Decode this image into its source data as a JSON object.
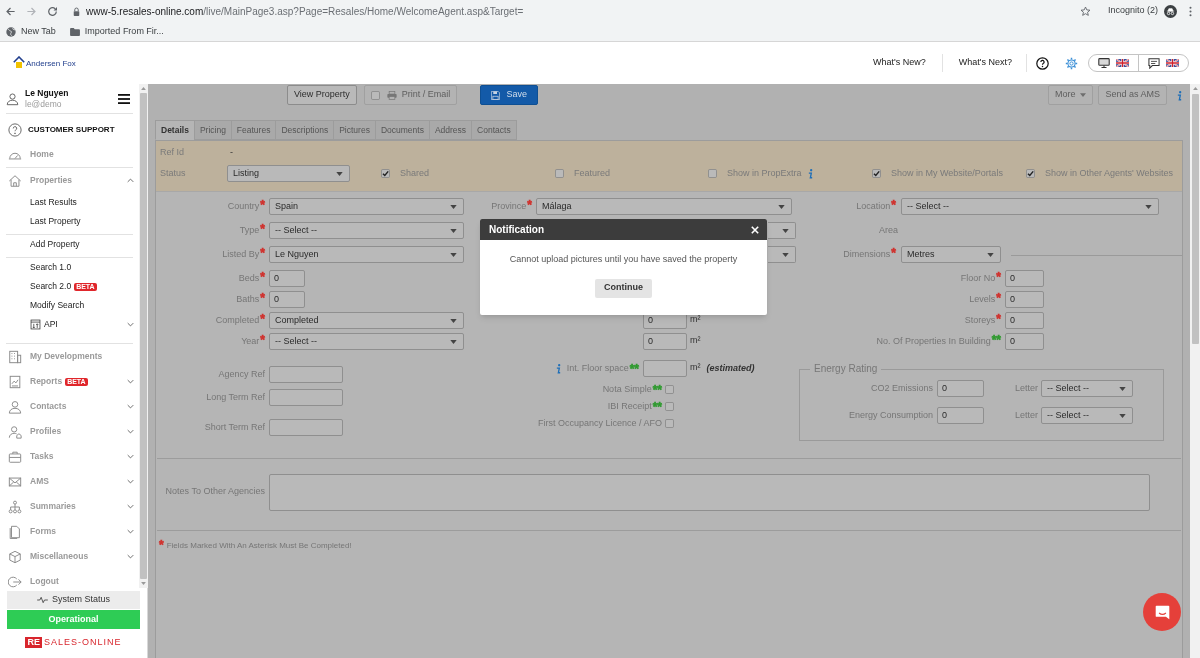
{
  "browser": {
    "url_host": "www-5.resales-online.com",
    "url_path": "/live/MainPage3.asp?Page=Resales/Home/WelcomeAgent.asp&Target=",
    "profile": "Incognito (2)",
    "bookmarks": [
      {
        "kind": "site",
        "label": "New Tab"
      },
      {
        "kind": "folder",
        "label": "Imported From Fir..."
      }
    ]
  },
  "header": {
    "logo": "Andersen Fox",
    "links": [
      "What's New?",
      "What's Next?"
    ],
    "language_buttons": [
      {
        "kind": "screen"
      },
      {
        "kind": "chat"
      }
    ]
  },
  "sidebar": {
    "user": {
      "name": "Le Nguyen",
      "email": "le@demo"
    },
    "support": "CUSTOMER SUPPORT",
    "items": [
      {
        "kind": "link",
        "label": "Home"
      },
      {
        "kind": "group",
        "label": "Properties",
        "expanded": true,
        "children": [
          {
            "items": [
              {
                "kind": "link",
                "label": "Last Results"
              },
              {
                "kind": "link",
                "label": "Last Property"
              }
            ]
          },
          {
            "items": [
              {
                "kind": "link",
                "label": "Add Property"
              }
            ]
          },
          {
            "items": [
              {
                "kind": "link",
                "label": "Search 1.0"
              },
              {
                "kind": "link",
                "label": "Search 2.0",
                "badge": "BETA"
              },
              {
                "kind": "link",
                "label": "Modify Search"
              },
              {
                "kind": "group",
                "label": "API",
                "expanded": false
              }
            ]
          }
        ]
      },
      {
        "kind": "link",
        "label": "My Developments"
      },
      {
        "kind": "group",
        "label": "Reports",
        "badge": "BETA",
        "expanded": false
      },
      {
        "kind": "group",
        "label": "Contacts",
        "expanded": false
      },
      {
        "kind": "group",
        "label": "Profiles",
        "expanded": false
      },
      {
        "kind": "group",
        "label": "Tasks",
        "expanded": false
      },
      {
        "kind": "group",
        "label": "AMS",
        "expanded": false
      },
      {
        "kind": "group",
        "label": "Summaries",
        "expanded": false
      },
      {
        "kind": "group",
        "label": "Forms",
        "expanded": false
      },
      {
        "kind": "group",
        "label": "Miscellaneous",
        "expanded": false
      },
      {
        "kind": "link",
        "label": "Logout"
      }
    ],
    "status": {
      "label": "System Status",
      "state": "Operational"
    },
    "brand": {
      "mark": "RE",
      "name": "SALES-ONLINE"
    }
  },
  "toolbar": {
    "buttons": [
      {
        "kind": "default",
        "label": "View Property",
        "disabled": false
      },
      {
        "kind": "print",
        "label": "Print / Email",
        "disabled": true,
        "checked": false
      },
      {
        "kind": "primary",
        "label": "Save",
        "disabled": false
      }
    ],
    "actions": [
      {
        "kind": "dropdown",
        "label": "More",
        "disabled": true
      },
      {
        "kind": "default",
        "label": "Send as AMS",
        "disabled": true
      }
    ]
  },
  "tabs": [
    {
      "label": "Details",
      "selected": true
    },
    {
      "label": "Pricing",
      "selected": false
    },
    {
      "label": "Features",
      "selected": false
    },
    {
      "label": "Descriptions",
      "selected": false
    },
    {
      "label": "Pictures",
      "selected": false
    },
    {
      "label": "Documents",
      "selected": false
    },
    {
      "label": "Address",
      "selected": false
    },
    {
      "label": "Contacts",
      "selected": false
    }
  ],
  "listing": {
    "ref_id": {
      "label": "Ref Id",
      "value": "-"
    },
    "status": {
      "label": "Status",
      "value": "Listing"
    },
    "flags": [
      {
        "label": "Shared",
        "checked": true
      },
      {
        "label": "Featured",
        "checked": false
      },
      {
        "label": "Show in PropExtra",
        "checked": false,
        "info": true
      },
      {
        "label": "Show in My Website/Portals",
        "checked": true
      },
      {
        "label": "Show in Other Agents' Websites",
        "checked": true
      }
    ]
  },
  "fields": {
    "left": [
      {
        "kind": "select",
        "label": "Country",
        "marker": {
          "text": "*",
          "color": "#d0312d"
        },
        "value": "Spain"
      },
      {
        "kind": "select",
        "label": "Type",
        "marker": {
          "text": "*",
          "color": "#d0312d"
        },
        "value": "-- Select --"
      },
      {
        "kind": "select",
        "label": "Listed By",
        "marker": {
          "text": "*",
          "color": "#d0312d"
        },
        "value": "Le Nguyen"
      },
      {
        "kind": "input",
        "label": "Beds",
        "marker": {
          "text": "*",
          "color": "#d0312d"
        },
        "value": "0"
      },
      {
        "kind": "input",
        "label": "Baths",
        "marker": {
          "text": "*",
          "color": "#d0312d"
        },
        "value": "0"
      },
      {
        "kind": "select",
        "label": "Completed",
        "marker": {
          "text": "*",
          "color": "#d0312d"
        },
        "value": "Completed"
      },
      {
        "kind": "select",
        "label": "Year",
        "marker": {
          "text": "*",
          "color": "#d0312d"
        },
        "value": "-- Select --"
      }
    ],
    "middle": {
      "selects": [
        {
          "kind": "select",
          "label": "Province",
          "marker": {
            "text": "*",
            "color": "#d0312d"
          },
          "value": "Málaga"
        },
        {
          "kind": "covered"
        },
        {
          "kind": "covered"
        }
      ],
      "sizes": [
        {
          "value": "0",
          "unit": "m²"
        },
        {
          "value": "0",
          "unit": "m²"
        }
      ]
    },
    "right": [
      {
        "kind": "select",
        "label": "Location",
        "marker": {
          "text": "*",
          "color": "#d0312d"
        },
        "value": "-- Select --"
      },
      {
        "kind": "text",
        "label": "Area"
      },
      {
        "kind": "unit_select",
        "label": "Dimensions",
        "marker": {
          "text": "*",
          "color": "#d0312d"
        },
        "value": "Metres"
      },
      {
        "kind": "input",
        "label": "Floor No",
        "marker": {
          "text": "*",
          "color": "#d0312d"
        },
        "value": "0"
      },
      {
        "kind": "input",
        "label": "Levels",
        "marker": {
          "text": "*",
          "color": "#d0312d"
        },
        "value": "0"
      },
      {
        "kind": "input",
        "label": "Storeys",
        "marker": {
          "text": "*",
          "color": "#d0312d"
        },
        "value": "0"
      },
      {
        "kind": "input",
        "label": "No. Of Properties In Building",
        "marker": {
          "text": "**",
          "color": "#2f9a2f"
        },
        "value": "0"
      }
    ]
  },
  "refs": [
    {
      "label": "Agency Ref"
    },
    {
      "label": "Long Term Ref"
    },
    {
      "label": "Short Term Ref"
    }
  ],
  "floor_space": {
    "label": "Int. Floor space",
    "marker": {
      "text": "**",
      "color": "#2f9a2f"
    },
    "unit": "m²",
    "note": "(estimated)"
  },
  "documents": [
    {
      "label": "Nota Simple",
      "marker": {
        "text": "**",
        "color": "#2f9a2f"
      },
      "checked": false
    },
    {
      "label": "IBI Receipt",
      "marker": {
        "text": "**",
        "color": "#2f9a2f"
      },
      "checked": false
    },
    {
      "label": "First Occupancy Licence / AFO",
      "checked": false
    }
  ],
  "energy": {
    "title": "Energy Rating",
    "rows": [
      {
        "label": "CO2 Emissions",
        "value": "0",
        "letter_label": "Letter",
        "letter": "-- Select --"
      },
      {
        "label": "Energy Consumption",
        "value": "0",
        "letter_label": "Letter",
        "letter": "-- Select --"
      }
    ]
  },
  "notes": {
    "label": "Notes To Other Agencies"
  },
  "footnote": {
    "marker": {
      "text": "*",
      "color": "#d0312d"
    },
    "text": "Fields Marked With An Asterisk Must Be Completed!"
  },
  "modal": {
    "title": "Notification",
    "message": "Cannot upload pictures until you have saved the property",
    "button": "Continue"
  }
}
